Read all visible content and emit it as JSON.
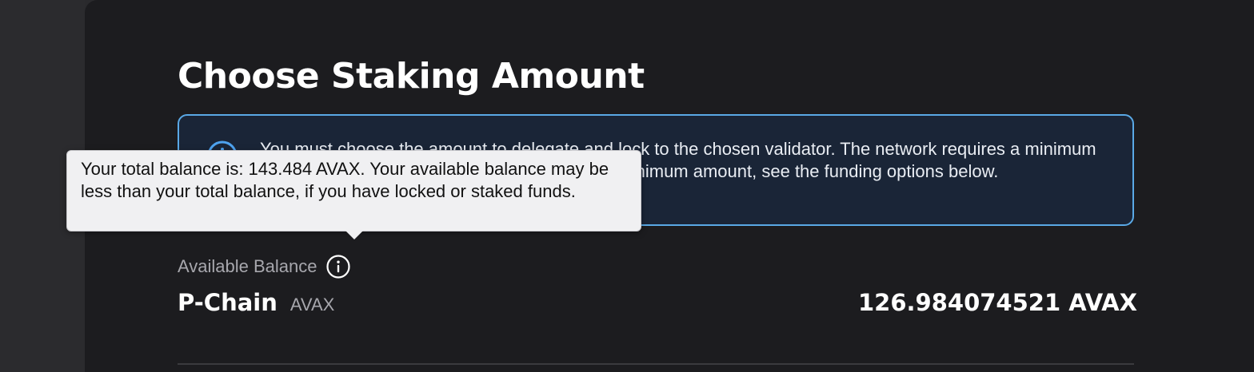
{
  "page": {
    "title": "Choose Staking Amount"
  },
  "info_banner": {
    "icon": "info-circle-icon",
    "text": "You must choose the amount to delegate and lock to the chosen validator. The network requires a minimum amount indicated below. If you don’t have the minimum amount, see the funding options below."
  },
  "balance": {
    "label": "Available Balance",
    "info_icon": "info-icon",
    "chain_name": "P-Chain",
    "token": "AVAX",
    "amount": "126.984074521 AVAX"
  },
  "tooltip": {
    "text": "Your total balance is: 143.484 AVAX. Your available balance may be less than your total balance, if you have locked or staked funds."
  },
  "colors": {
    "background": "#1c1c1f",
    "banner_background": "#1a2537",
    "banner_border": "#5aa9e6",
    "tooltip_background": "#f0f0f2",
    "text_primary": "#ffffff",
    "text_muted": "#a7a7ad"
  }
}
